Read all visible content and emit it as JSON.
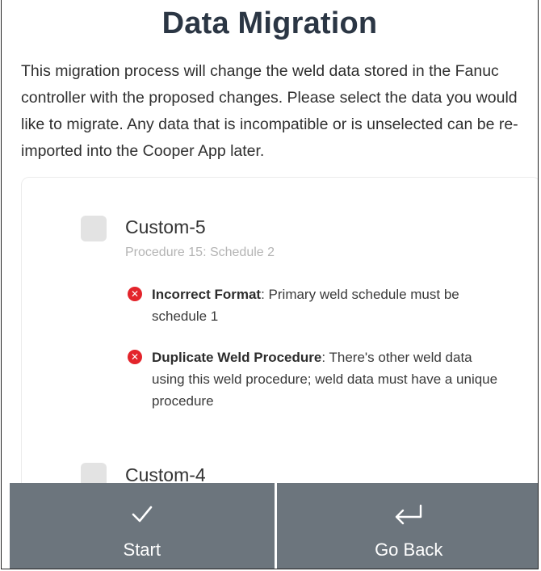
{
  "page": {
    "title": "Data Migration",
    "intro": "This migration process will change the weld data stored in the Fanuc controller with the proposed changes. Please select the data you would like to migrate. Any data that is incompatible or is unselected can be re-imported into the Cooper App later."
  },
  "items": [
    {
      "name": "Custom-5",
      "subtitle": "Procedure 15: Schedule 2",
      "errors": [
        {
          "title": "Incorrect Format",
          "message": ": Primary weld schedule must be schedule 1"
        },
        {
          "title": "Duplicate Weld Procedure",
          "message": ": There's other weld data using this weld procedure; weld data must have a unique procedure"
        }
      ]
    },
    {
      "name": "Custom-4"
    }
  ],
  "actions": {
    "start_label": "Start",
    "back_label": "Go Back"
  },
  "icons": {
    "error": "error-circle-icon",
    "start": "checkmark-icon",
    "back": "return-arrow-icon"
  },
  "colors": {
    "title": "#2b3644",
    "error": "#e3242b",
    "bar": "#6c757d"
  }
}
